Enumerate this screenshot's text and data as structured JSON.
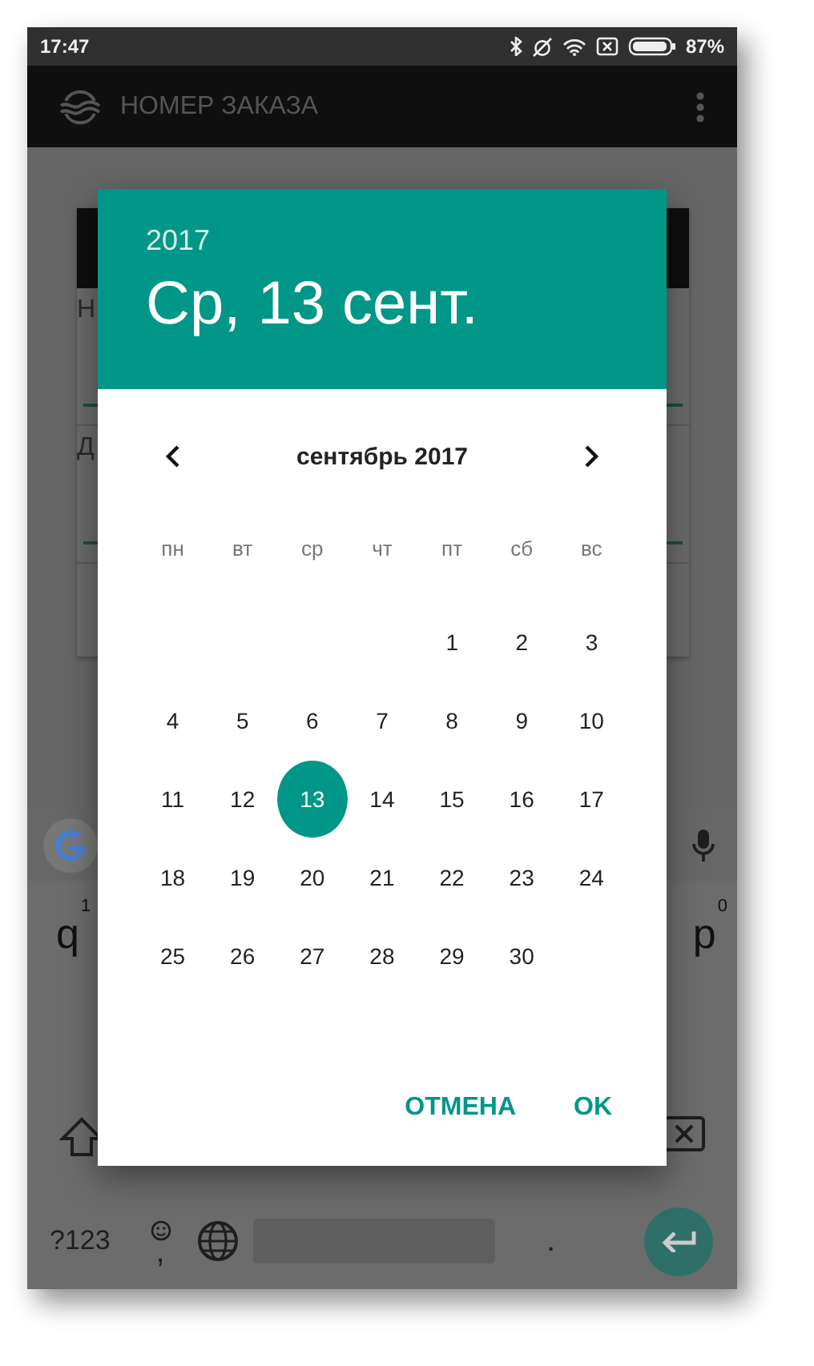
{
  "status_bar": {
    "time": "17:47",
    "battery": "87%"
  },
  "app_bar": {
    "title": "НОМЕР ЗАКАЗА"
  },
  "form": {
    "fields": [
      {
        "label": "Н"
      },
      {
        "label": "Д"
      }
    ]
  },
  "keyboard": {
    "top_row": [
      {
        "key": "q",
        "hint": "1"
      },
      {
        "key": "p",
        "hint": "0"
      }
    ],
    "mode_key": "?123",
    "comma_key": ",",
    "period_key": "."
  },
  "dialog": {
    "year": "2017",
    "date": "Ср, 13 сент.",
    "month": "сентябрь 2017",
    "weekdays": [
      "пн",
      "вт",
      "ср",
      "чт",
      "пт",
      "сб",
      "вс"
    ],
    "weeks": [
      {
        "kind": "lead",
        "days": [
          {
            "day": "1",
            "selected": false
          },
          {
            "day": "2",
            "selected": false
          },
          {
            "day": "3",
            "selected": false
          }
        ]
      },
      {
        "kind": "full",
        "days": [
          {
            "day": "4",
            "selected": false
          },
          {
            "day": "5",
            "selected": false
          },
          {
            "day": "6",
            "selected": false
          },
          {
            "day": "7",
            "selected": false
          },
          {
            "day": "8",
            "selected": false
          },
          {
            "day": "9",
            "selected": false
          },
          {
            "day": "10",
            "selected": false
          }
        ]
      },
      {
        "kind": "full",
        "days": [
          {
            "day": "11",
            "selected": false
          },
          {
            "day": "12",
            "selected": false
          },
          {
            "day": "13",
            "selected": true
          },
          {
            "day": "14",
            "selected": false
          },
          {
            "day": "15",
            "selected": false
          },
          {
            "day": "16",
            "selected": false
          },
          {
            "day": "17",
            "selected": false
          }
        ]
      },
      {
        "kind": "full",
        "days": [
          {
            "day": "18",
            "selected": false
          },
          {
            "day": "19",
            "selected": false
          },
          {
            "day": "20",
            "selected": false
          },
          {
            "day": "21",
            "selected": false
          },
          {
            "day": "22",
            "selected": false
          },
          {
            "day": "23",
            "selected": false
          },
          {
            "day": "24",
            "selected": false
          }
        ]
      },
      {
        "kind": "full",
        "days": [
          {
            "day": "25",
            "selected": false
          },
          {
            "day": "26",
            "selected": false
          },
          {
            "day": "27",
            "selected": false
          },
          {
            "day": "28",
            "selected": false
          },
          {
            "day": "29",
            "selected": false
          },
          {
            "day": "30",
            "selected": false
          }
        ]
      }
    ],
    "buttons": [
      "ОТМЕНА",
      "OK"
    ]
  }
}
